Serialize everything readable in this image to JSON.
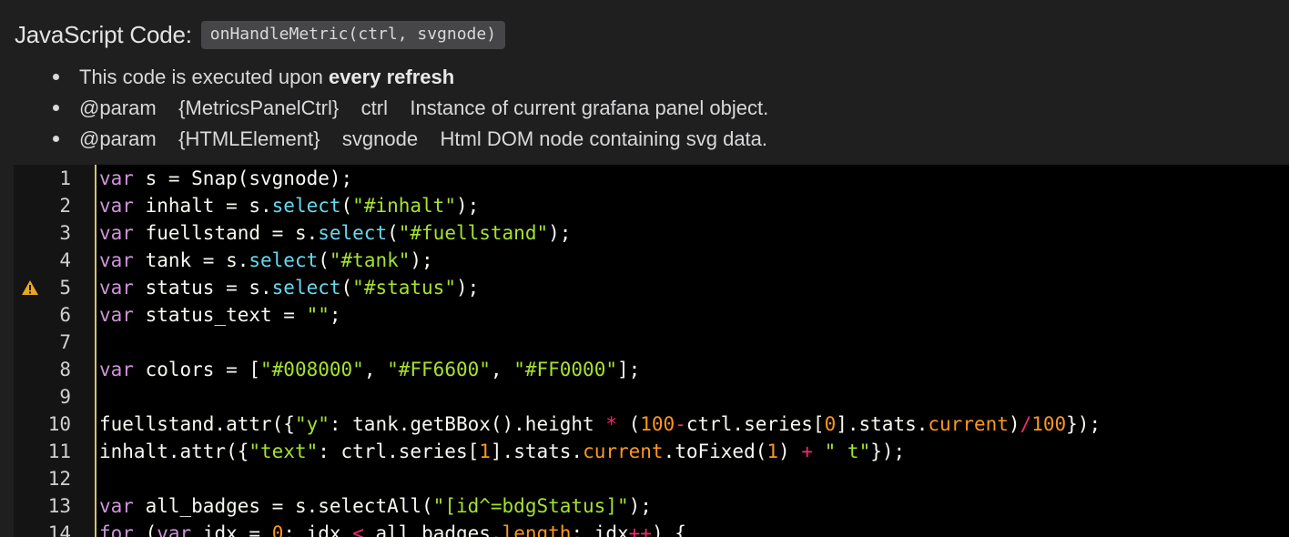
{
  "header": {
    "title": "JavaScript Code:",
    "function_signature": "onHandleMetric(ctrl, svgnode)"
  },
  "info": [
    {
      "text": "This code is executed upon ",
      "bold": "every refresh"
    },
    {
      "text": "@param    {MetricsPanelCtrl}    ctrl    Instance of current grafana panel object.",
      "bold": ""
    },
    {
      "text": "@param    {HTMLElement}    svgnode    Html DOM node containing svg data.",
      "bold": ""
    }
  ],
  "editor": {
    "warning_line": 5,
    "fold_line": 14,
    "lines": [
      {
        "n": "1",
        "tokens": [
          [
            "kw",
            "var"
          ],
          [
            "txt",
            " s = Snap(svgnode);"
          ]
        ]
      },
      {
        "n": "2",
        "tokens": [
          [
            "kw",
            "var"
          ],
          [
            "txt",
            " inhalt = s."
          ],
          [
            "fn",
            "select"
          ],
          [
            "txt",
            "("
          ],
          [
            "str",
            "\"#inhalt\""
          ],
          [
            "txt",
            ");"
          ]
        ]
      },
      {
        "n": "3",
        "tokens": [
          [
            "kw",
            "var"
          ],
          [
            "txt",
            " fuellstand = s."
          ],
          [
            "fn",
            "select"
          ],
          [
            "txt",
            "("
          ],
          [
            "str",
            "\"#fuellstand\""
          ],
          [
            "txt",
            ");"
          ]
        ]
      },
      {
        "n": "4",
        "tokens": [
          [
            "kw",
            "var"
          ],
          [
            "txt",
            " tank = s."
          ],
          [
            "fn",
            "select"
          ],
          [
            "txt",
            "("
          ],
          [
            "str",
            "\"#tank\""
          ],
          [
            "txt",
            ");"
          ]
        ]
      },
      {
        "n": "5",
        "tokens": [
          [
            "kw",
            "var"
          ],
          [
            "txt",
            " status = s."
          ],
          [
            "fn",
            "select"
          ],
          [
            "txt",
            "("
          ],
          [
            "str",
            "\"#status\""
          ],
          [
            "txt",
            ");"
          ]
        ]
      },
      {
        "n": "6",
        "tokens": [
          [
            "kw",
            "var"
          ],
          [
            "txt",
            " status_text = "
          ],
          [
            "str",
            "\"\""
          ],
          [
            "txt",
            ";"
          ]
        ]
      },
      {
        "n": "7",
        "tokens": []
      },
      {
        "n": "8",
        "tokens": [
          [
            "kw",
            "var"
          ],
          [
            "txt",
            " colors = ["
          ],
          [
            "str",
            "\"#008000\""
          ],
          [
            "txt",
            ", "
          ],
          [
            "str",
            "\"#FF6600\""
          ],
          [
            "txt",
            ", "
          ],
          [
            "str",
            "\"#FF0000\""
          ],
          [
            "txt",
            "];"
          ]
        ]
      },
      {
        "n": "9",
        "tokens": []
      },
      {
        "n": "10",
        "tokens": [
          [
            "txt",
            "fuellstand.attr({"
          ],
          [
            "str",
            "\"y\""
          ],
          [
            "txt",
            ": tank.getBBox().height "
          ],
          [
            "op",
            "*"
          ],
          [
            "txt",
            " ("
          ],
          [
            "num",
            "100"
          ],
          [
            "op",
            "-"
          ],
          [
            "txt",
            "ctrl.series["
          ],
          [
            "num",
            "0"
          ],
          [
            "txt",
            "].stats."
          ],
          [
            "prop",
            "current"
          ],
          [
            "txt",
            ")"
          ],
          [
            "op",
            "/"
          ],
          [
            "num",
            "100"
          ],
          [
            "txt",
            "});"
          ]
        ]
      },
      {
        "n": "11",
        "tokens": [
          [
            "txt",
            "inhalt.attr({"
          ],
          [
            "str",
            "\"text\""
          ],
          [
            "txt",
            ": ctrl.series["
          ],
          [
            "num",
            "1"
          ],
          [
            "txt",
            "].stats."
          ],
          [
            "prop",
            "current"
          ],
          [
            "txt",
            ".toFixed("
          ],
          [
            "num",
            "1"
          ],
          [
            "txt",
            ") "
          ],
          [
            "op",
            "+"
          ],
          [
            "txt",
            " "
          ],
          [
            "str",
            "\" t\""
          ],
          [
            "txt",
            "});"
          ]
        ]
      },
      {
        "n": "12",
        "tokens": []
      },
      {
        "n": "13",
        "tokens": [
          [
            "kw",
            "var"
          ],
          [
            "txt",
            " all_badges = s.selectAll("
          ],
          [
            "str",
            "\"[id^=bdgStatus]\""
          ],
          [
            "txt",
            ");"
          ]
        ]
      },
      {
        "n": "14",
        "tokens": [
          [
            "kw",
            "for"
          ],
          [
            "txt",
            " ("
          ],
          [
            "kw",
            "var"
          ],
          [
            "txt",
            " idx = "
          ],
          [
            "num",
            "0"
          ],
          [
            "txt",
            "; idx "
          ],
          [
            "op",
            "<"
          ],
          [
            "txt",
            " all_badges."
          ],
          [
            "prop",
            "length"
          ],
          [
            "txt",
            "; idx"
          ],
          [
            "op",
            "++"
          ],
          [
            "txt",
            ") {"
          ]
        ]
      }
    ]
  }
}
